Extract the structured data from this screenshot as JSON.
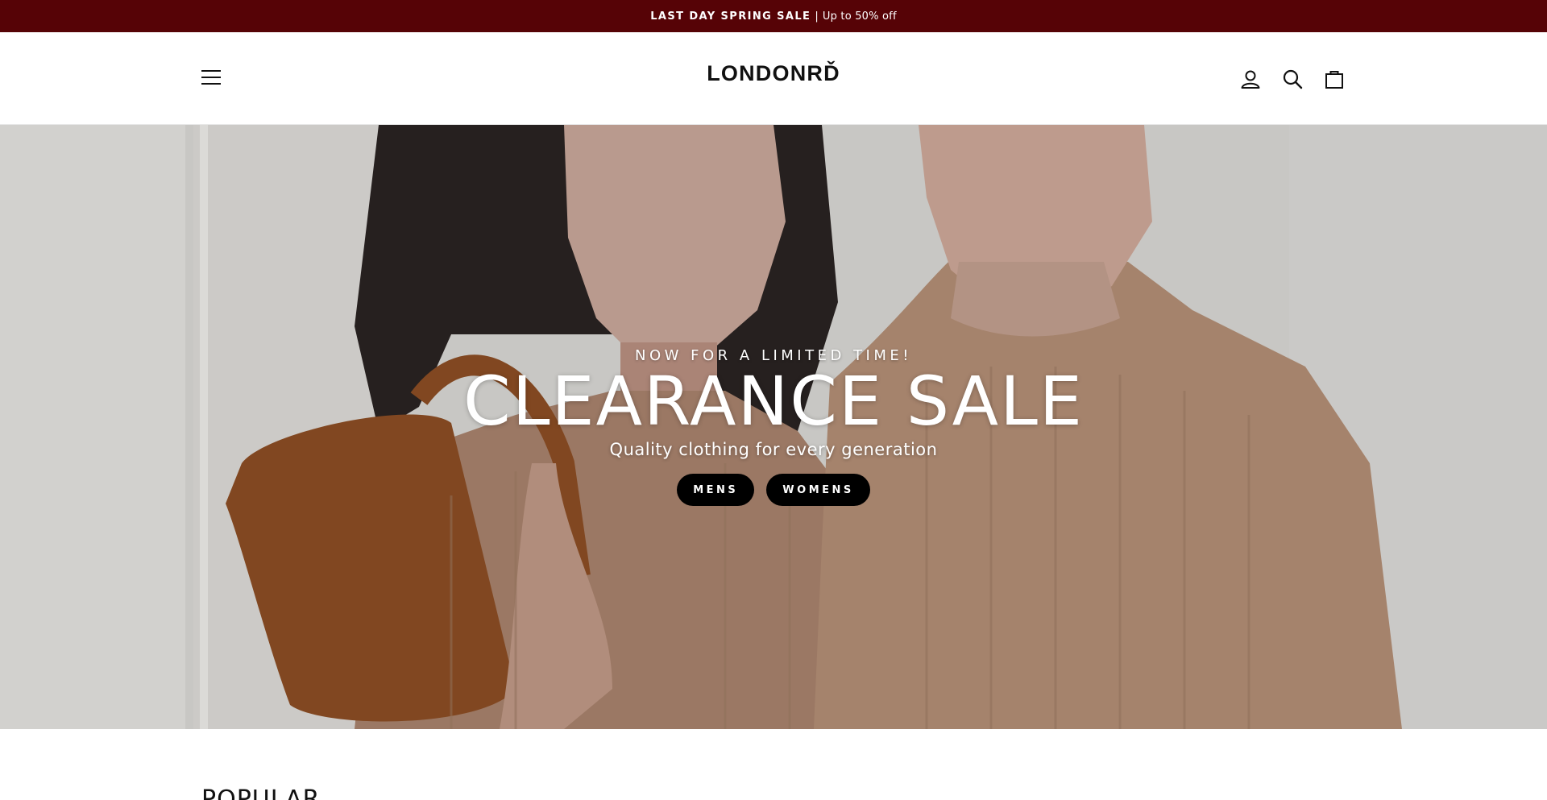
{
  "announcement": {
    "strong": "LAST DAY SPRING SALE",
    "separator": "|",
    "text": "Up to 50% off",
    "background": "#560306"
  },
  "header": {
    "logo": "LONDONRĎ",
    "icons": {
      "menu": "hamburger-menu-icon",
      "account": "user-icon",
      "search": "search-icon",
      "cart": "shopping-bag-icon"
    }
  },
  "hero": {
    "subheading": "NOW FOR A LIMITED TIME!",
    "title": "CLEARANCE SALE",
    "tagline": "Quality clothing for every generation",
    "buttons": [
      {
        "label": "MENS"
      },
      {
        "label": "WOMENS"
      }
    ],
    "button_color": "#000000"
  },
  "section": {
    "title": "POPULAR"
  }
}
